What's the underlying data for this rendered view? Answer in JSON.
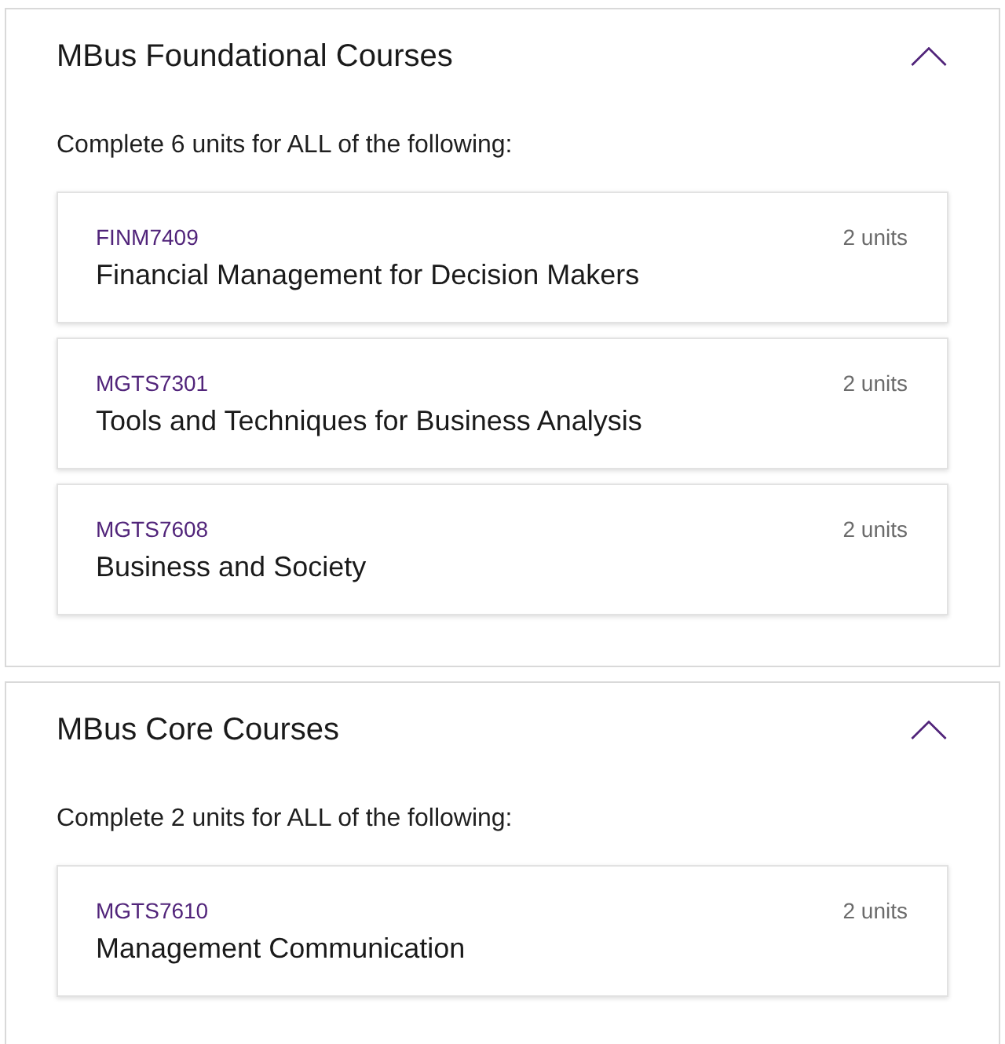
{
  "sections": [
    {
      "title": "MBus Foundational Courses",
      "expanded": true,
      "requirement": "Complete 6 units for ALL of the following:",
      "courses": [
        {
          "code": "FINM7409",
          "name": "Financial Management for Decision Makers",
          "units": "2 units"
        },
        {
          "code": "MGTS7301",
          "name": "Tools and Techniques for Business Analysis",
          "units": "2 units"
        },
        {
          "code": "MGTS7608",
          "name": "Business and Society",
          "units": "2 units"
        }
      ]
    },
    {
      "title": "MBus Core Courses",
      "expanded": true,
      "requirement": "Complete 2 units for ALL of the following:",
      "courses": [
        {
          "code": "MGTS7610",
          "name": "Management Communication",
          "units": "2 units"
        }
      ]
    }
  ]
}
